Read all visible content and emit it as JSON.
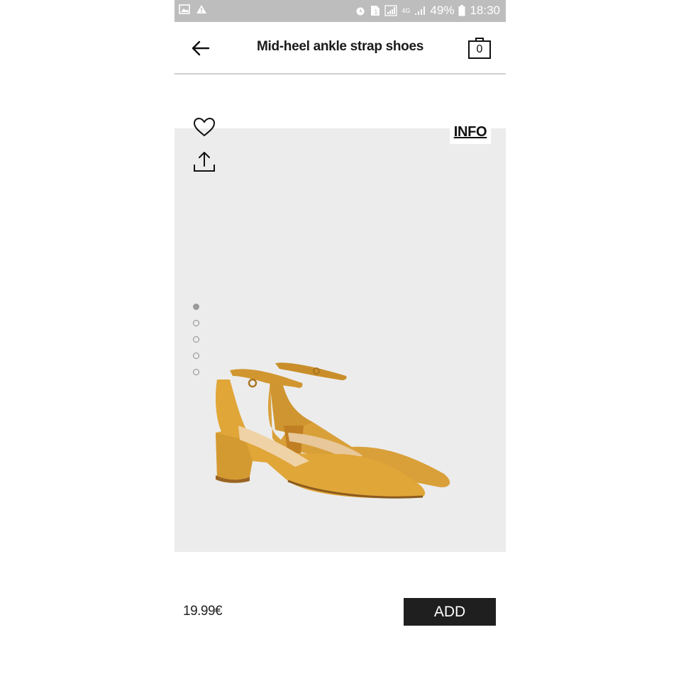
{
  "status_bar": {
    "battery": "49%",
    "time": "18:30",
    "network": "4G"
  },
  "header": {
    "title": "Mid-heel ankle strap shoes",
    "bag_count": "0"
  },
  "product": {
    "info_label": "INFO",
    "image_count": 5,
    "active_image_index": 0,
    "color": "#d9a03a"
  },
  "footer": {
    "price": "19.99€",
    "add_label": "ADD"
  }
}
